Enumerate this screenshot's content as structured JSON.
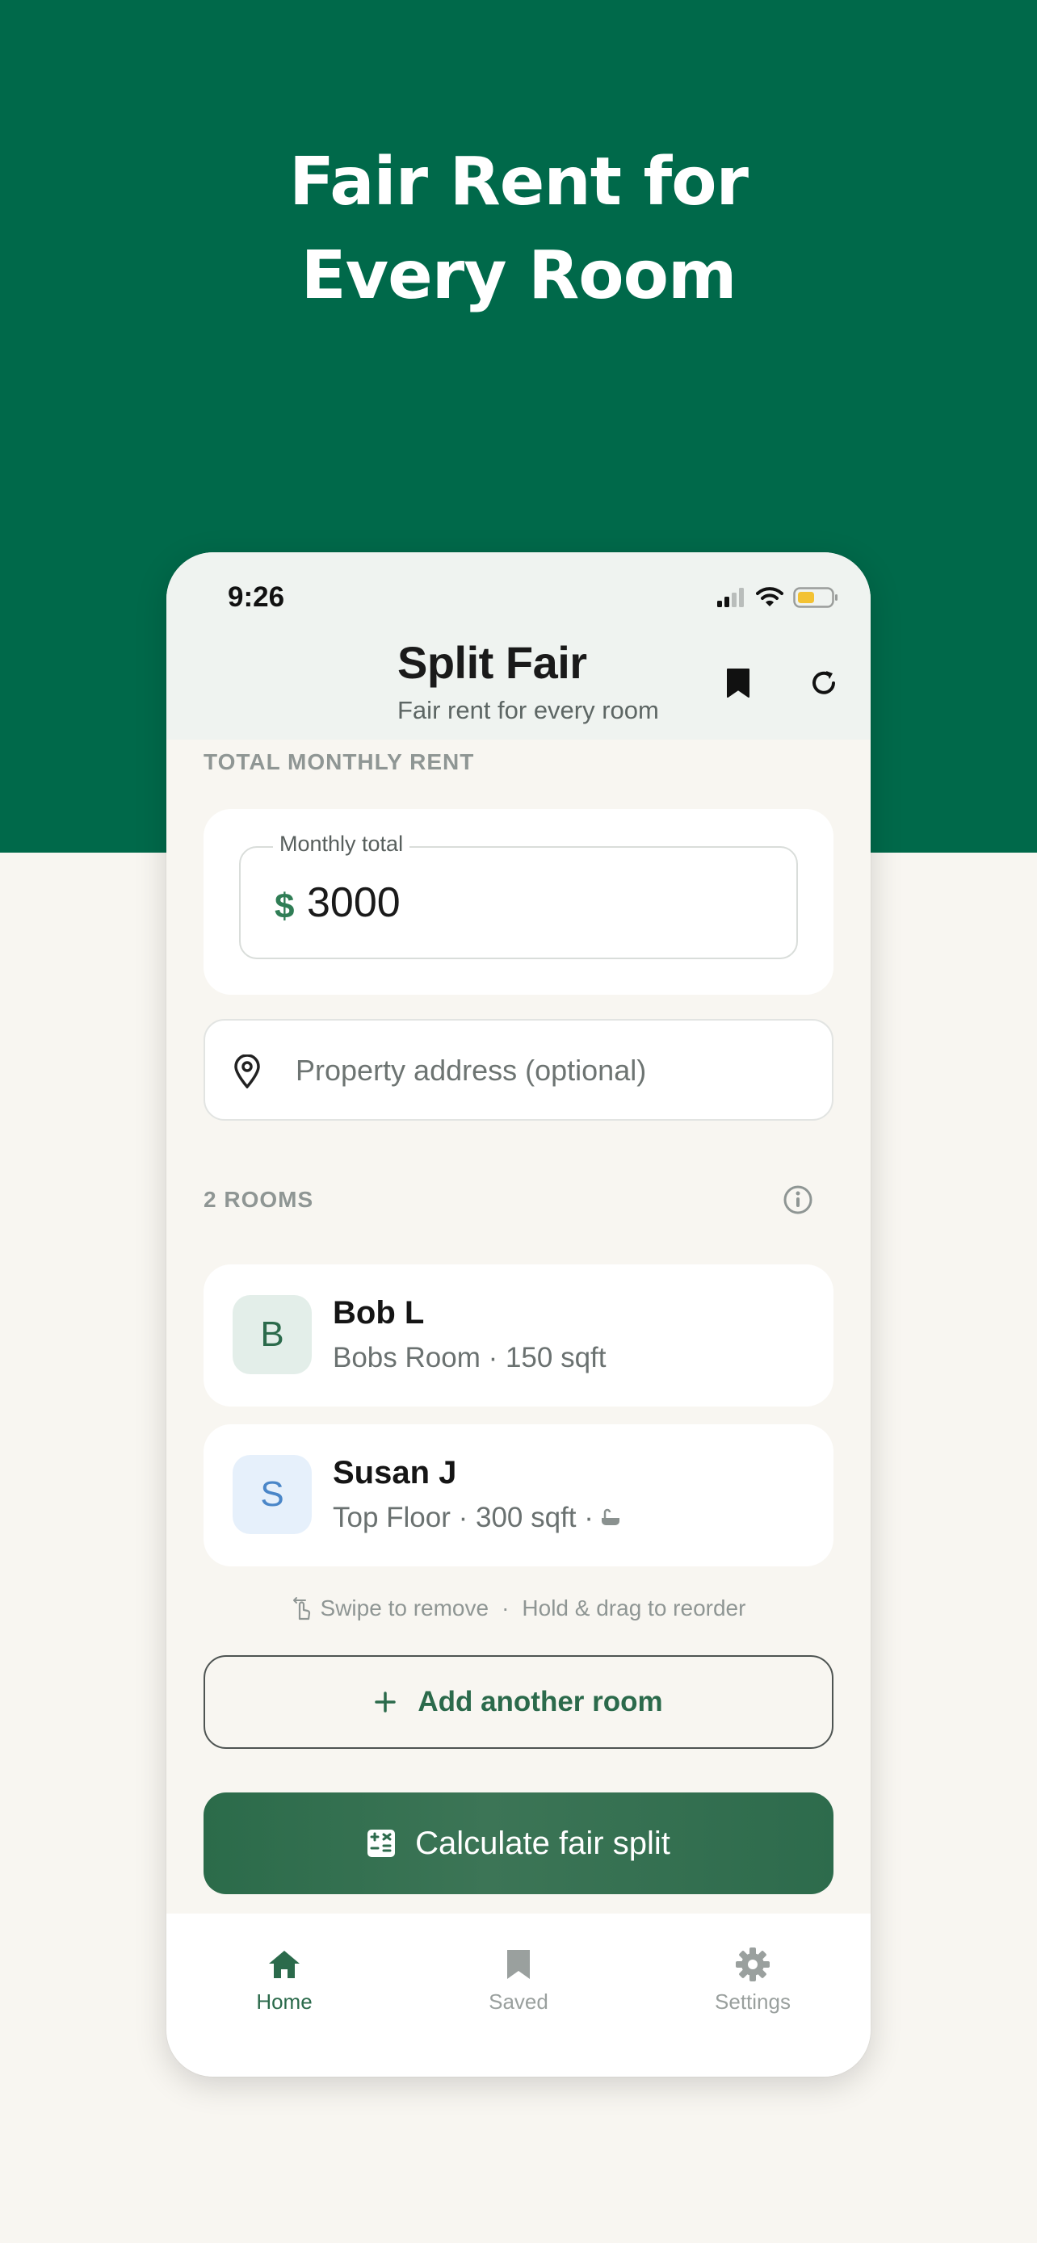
{
  "hero": {
    "title_line1": "Fair Rent for",
    "title_line2": "Every Room"
  },
  "status_bar": {
    "time": "9:26"
  },
  "header": {
    "title": "Split Fair",
    "subtitle": "Fair rent for every room",
    "icons": [
      "bookmark-icon",
      "refresh-icon"
    ]
  },
  "rent": {
    "section_label": "TOTAL MONTHLY RENT",
    "field_label": "Monthly total",
    "currency": "$",
    "value": "3000"
  },
  "address": {
    "placeholder": "Property address (optional)",
    "icon": "location-pin-icon"
  },
  "rooms": {
    "section_label": "2 ROOMS",
    "items": [
      {
        "initial": "B",
        "name": "Bob L",
        "details": "Bobs Room · 150 sqft",
        "avatar_bg": "#e3eee9",
        "avatar_color": "#2b6a4b",
        "extra_icon": ""
      },
      {
        "initial": "S",
        "name": "Susan J",
        "details": "Top Floor · 300 sqft ·",
        "avatar_bg": "#e6f0fb",
        "avatar_color": "#4a86c8",
        "extra_icon": "bathtub-icon"
      }
    ]
  },
  "hints": {
    "swipe": "Swipe to remove",
    "separator": "·",
    "drag": "Hold & drag to reorder"
  },
  "buttons": {
    "add_room": "Add another room",
    "calculate": "Calculate fair split"
  },
  "tabbar": {
    "tabs": [
      {
        "label": "Home",
        "icon": "home-icon",
        "active": true
      },
      {
        "label": "Saved",
        "icon": "bookmark-icon",
        "active": false
      },
      {
        "label": "Settings",
        "icon": "gear-icon",
        "active": false
      }
    ]
  },
  "colors": {
    "brand_green": "#00694a",
    "accent_green": "#2b6a4b",
    "inactive": "#9aa09e"
  }
}
